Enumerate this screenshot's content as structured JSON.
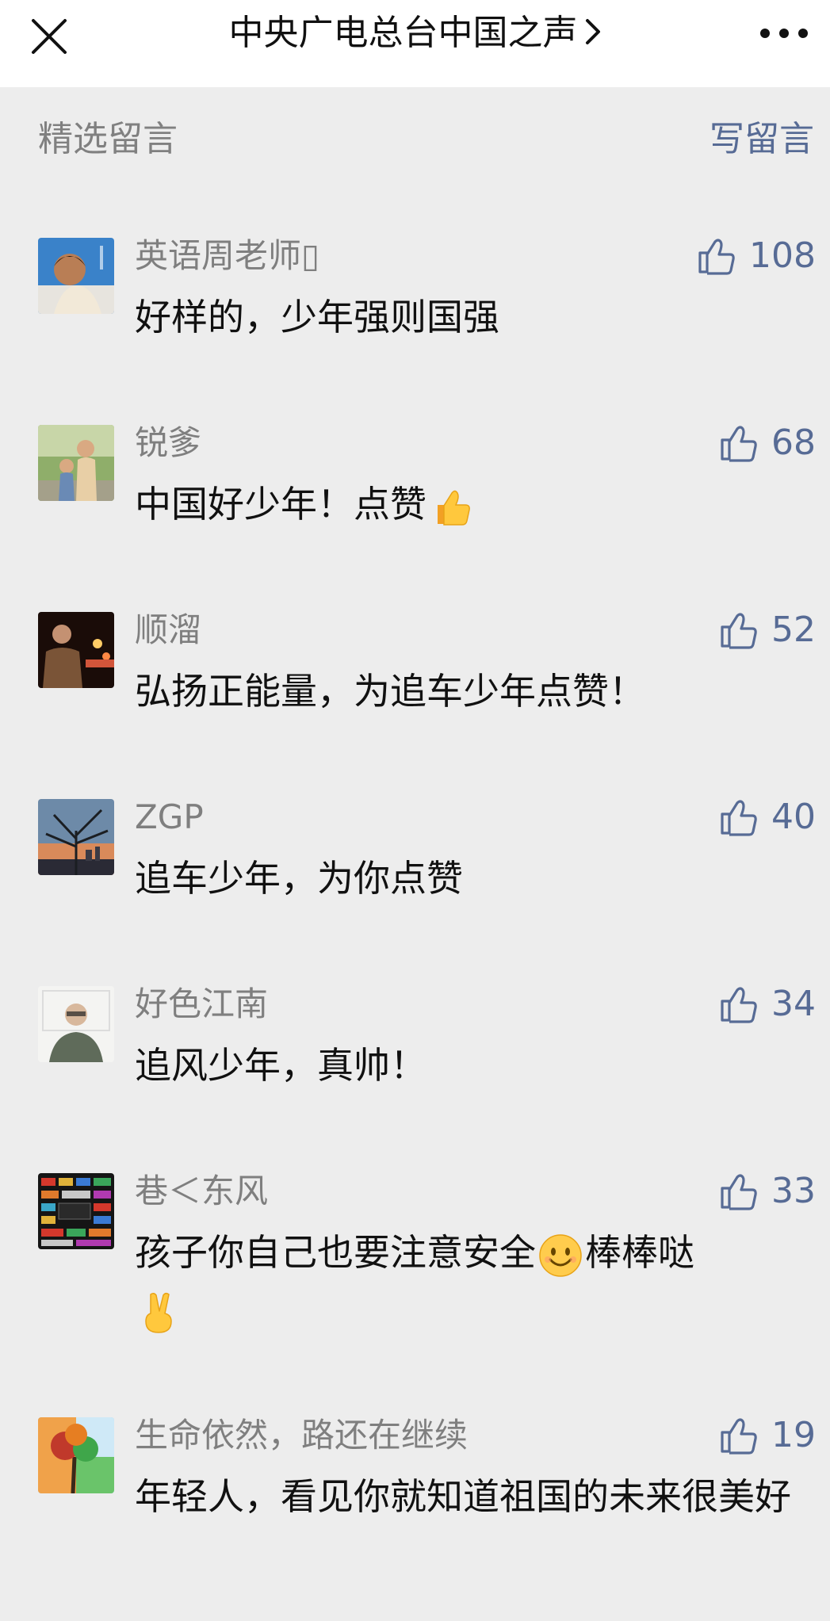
{
  "header": {
    "title": "中央广电总台中国之声",
    "close_icon": "close-icon",
    "chevron_icon": "chevron-right-icon",
    "more_icon": "more-icon"
  },
  "section": {
    "title": "精选留言",
    "write_label": "写留言"
  },
  "comments": [
    {
      "nickname": "英语周老师▯",
      "likes": "108",
      "text": "好样的，少年强则国强",
      "avatar": "avatar-boy-smiling"
    },
    {
      "nickname": "锐爹",
      "likes": "68",
      "text": "中国好少年！点赞",
      "emoji_after": "thumbs-up-emoji",
      "avatar": "avatar-family-outdoor"
    },
    {
      "nickname": "顺溜",
      "likes": "52",
      "text": "弘扬正能量，为追车少年点赞！",
      "avatar": "avatar-man-night-lights"
    },
    {
      "nickname": "ZGP",
      "likes": "40",
      "text": "追车少年，为你点赞",
      "avatar": "avatar-tree-skyline"
    },
    {
      "nickname": "好色江南",
      "likes": "34",
      "text": "追风少年，真帅！",
      "avatar": "avatar-man-glasses"
    },
    {
      "nickname": "巷＜东风",
      "likes": "33",
      "text_part1": "孩子你自己也要注意安全",
      "text_part2": "棒棒哒",
      "emoji_mid": "smile-emoji",
      "emoji_end": "victory-hand-emoji",
      "avatar": "avatar-mosaic"
    },
    {
      "nickname": "生命依然，路还在继续",
      "likes": "19",
      "text": "年轻人，看见你就知道祖国的未来很美好",
      "avatar": "avatar-colorful-tree"
    }
  ],
  "colors": {
    "background": "#ededed",
    "link": "#576b95",
    "nickname": "#7f7f7f",
    "section_title": "#808080"
  }
}
